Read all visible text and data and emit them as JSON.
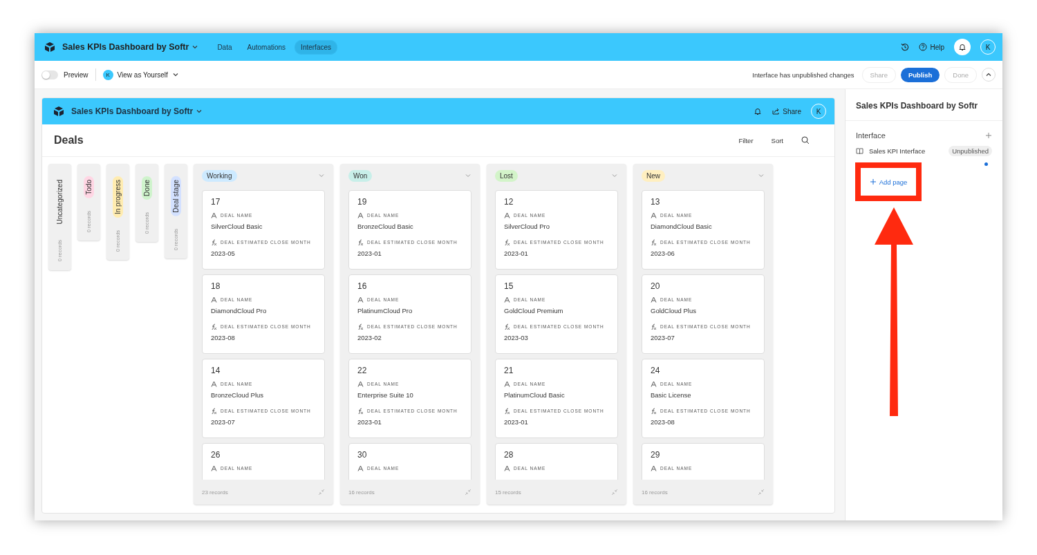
{
  "top_bar": {
    "app_title": "Sales KPIs Dashboard by Softr",
    "nav": [
      {
        "label": "Data",
        "selected": false
      },
      {
        "label": "Automations",
        "selected": false
      },
      {
        "label": "Interfaces",
        "selected": true
      }
    ],
    "help": "Help",
    "avatar": "K"
  },
  "toolbar": {
    "preview": {
      "label": "Preview",
      "on": false
    },
    "view_as": {
      "avatar": "K",
      "label": "View as Yourself"
    },
    "status": "Interface has unpublished changes",
    "buttons": [
      {
        "label": "Share",
        "kind": "ghost"
      },
      {
        "label": "Publish",
        "kind": "primary"
      },
      {
        "label": "Done",
        "kind": "ghost"
      }
    ]
  },
  "interface": {
    "title": "Sales KPIs Dashboard by Softr",
    "share": "Share",
    "avatar": "K",
    "page_title": "Deals",
    "actions": [
      "Filter",
      "Sort"
    ],
    "collapsed_groups": [
      {
        "label": "Uncategorized",
        "records": "0 records"
      },
      {
        "label": "Todo",
        "color": "#ffd6e4",
        "records": "0 records"
      },
      {
        "label": "In progress",
        "color": "#ffecb0",
        "records": "0 records"
      },
      {
        "label": "Done",
        "color": "#cff3cc",
        "records": "0 records"
      },
      {
        "label": "Deal stage",
        "color": "#d3e1ff",
        "records": "0 records"
      }
    ],
    "groups": [
      {
        "label": "Working",
        "color": "#cdeaff",
        "records": "23 records",
        "cards": [
          {
            "id": "17",
            "fields": [
              {
                "kind": "text",
                "label": "DEAL NAME",
                "value": "SilverCloud Basic"
              },
              {
                "kind": "formula",
                "label": "DEAL ESTIMATED CLOSE MONTH",
                "value": "2023-05"
              }
            ]
          },
          {
            "id": "18",
            "fields": [
              {
                "kind": "text",
                "label": "DEAL NAME",
                "value": "DiamondCloud Pro"
              },
              {
                "kind": "formula",
                "label": "DEAL ESTIMATED CLOSE MONTH",
                "value": "2023-08"
              }
            ]
          },
          {
            "id": "14",
            "fields": [
              {
                "kind": "text",
                "label": "DEAL NAME",
                "value": "BronzeCloud Plus"
              },
              {
                "kind": "formula",
                "label": "DEAL ESTIMATED CLOSE MONTH",
                "value": "2023-07"
              }
            ]
          },
          {
            "id": "26",
            "fields": [
              {
                "kind": "text",
                "label": "DEAL NAME"
              }
            ]
          }
        ]
      },
      {
        "label": "Won",
        "color": "#c8efe9",
        "records": "16 records",
        "cards": [
          {
            "id": "19",
            "fields": [
              {
                "kind": "text",
                "label": "DEAL NAME",
                "value": "BronzeCloud Basic"
              },
              {
                "kind": "formula",
                "label": "DEAL ESTIMATED CLOSE MONTH",
                "value": "2023-01"
              }
            ]
          },
          {
            "id": "16",
            "fields": [
              {
                "kind": "text",
                "label": "DEAL NAME",
                "value": "PlatinumCloud Pro"
              },
              {
                "kind": "formula",
                "label": "DEAL ESTIMATED CLOSE MONTH",
                "value": "2023-02"
              }
            ]
          },
          {
            "id": "22",
            "fields": [
              {
                "kind": "text",
                "label": "DEAL NAME",
                "value": "Enterprise Suite 10"
              },
              {
                "kind": "formula",
                "label": "DEAL ESTIMATED CLOSE MONTH",
                "value": "2023-01"
              }
            ]
          },
          {
            "id": "30",
            "fields": [
              {
                "kind": "text",
                "label": "DEAL NAME"
              }
            ]
          }
        ]
      },
      {
        "label": "Lost",
        "color": "#d3f4c9",
        "records": "15 records",
        "cards": [
          {
            "id": "12",
            "fields": [
              {
                "kind": "text",
                "label": "DEAL NAME",
                "value": "SilverCloud Pro"
              },
              {
                "kind": "formula",
                "label": "DEAL ESTIMATED CLOSE MONTH",
                "value": "2023-01"
              }
            ]
          },
          {
            "id": "15",
            "fields": [
              {
                "kind": "text",
                "label": "DEAL NAME",
                "value": "GoldCloud Premium"
              },
              {
                "kind": "formula",
                "label": "DEAL ESTIMATED CLOSE MONTH",
                "value": "2023-03"
              }
            ]
          },
          {
            "id": "21",
            "fields": [
              {
                "kind": "text",
                "label": "DEAL NAME",
                "value": "PlatinumCloud Basic"
              },
              {
                "kind": "formula",
                "label": "DEAL ESTIMATED CLOSE MONTH",
                "value": "2023-01"
              }
            ]
          },
          {
            "id": "28",
            "fields": [
              {
                "kind": "text",
                "label": "DEAL NAME"
              }
            ]
          }
        ]
      },
      {
        "label": "New",
        "color": "#ffefc0",
        "records": "16 records",
        "cards": [
          {
            "id": "13",
            "fields": [
              {
                "kind": "text",
                "label": "DEAL NAME",
                "value": "DiamondCloud Basic"
              },
              {
                "kind": "formula",
                "label": "DEAL ESTIMATED CLOSE MONTH",
                "value": "2023-06"
              }
            ]
          },
          {
            "id": "20",
            "fields": [
              {
                "kind": "text",
                "label": "DEAL NAME",
                "value": "GoldCloud Plus"
              },
              {
                "kind": "formula",
                "label": "DEAL ESTIMATED CLOSE MONTH",
                "value": "2023-07"
              }
            ]
          },
          {
            "id": "24",
            "fields": [
              {
                "kind": "text",
                "label": "DEAL NAME",
                "value": "Basic License"
              },
              {
                "kind": "formula",
                "label": "DEAL ESTIMATED CLOSE MONTH",
                "value": "2023-08"
              }
            ]
          },
          {
            "id": "29",
            "fields": [
              {
                "kind": "text",
                "label": "DEAL NAME"
              }
            ]
          }
        ]
      }
    ]
  },
  "side_panel": {
    "title": "Sales KPIs Dashboard by Softr",
    "section": "Interface",
    "items": [
      {
        "label": "Sales KPI Interface",
        "badge": "Unpublished",
        "unsaved": true
      }
    ],
    "add_page": "Add page"
  }
}
